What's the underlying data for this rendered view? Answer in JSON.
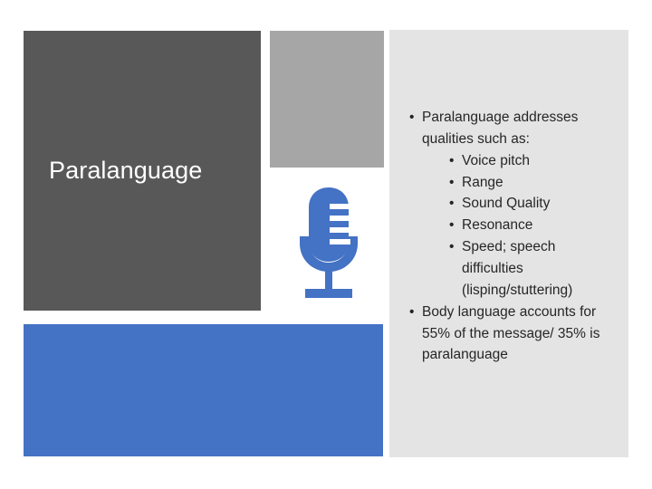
{
  "slide": {
    "title": "Paralanguage",
    "colors": {
      "title_block": "#585858",
      "accent_blue": "#4472C4",
      "mid_gray": "#A6A6A6",
      "panel_gray": "#E4E4E4",
      "title_text": "#FFFFFF",
      "body_text": "#262626"
    },
    "bullet_glyph": "•",
    "icon": {
      "name": "microphone-icon",
      "color": "#4472C4"
    },
    "content": [
      {
        "text": "Paralanguage addresses qualities such as:",
        "children": [
          {
            "text": "Voice pitch"
          },
          {
            "text": "Range"
          },
          {
            "text": "Sound Quality"
          },
          {
            "text": "Resonance"
          },
          {
            "text": "Speed; speech difficulties (lisping/stuttering)"
          }
        ]
      },
      {
        "text": "Body language accounts for 55% of the message/ 35% is paralanguage",
        "children": []
      }
    ]
  }
}
